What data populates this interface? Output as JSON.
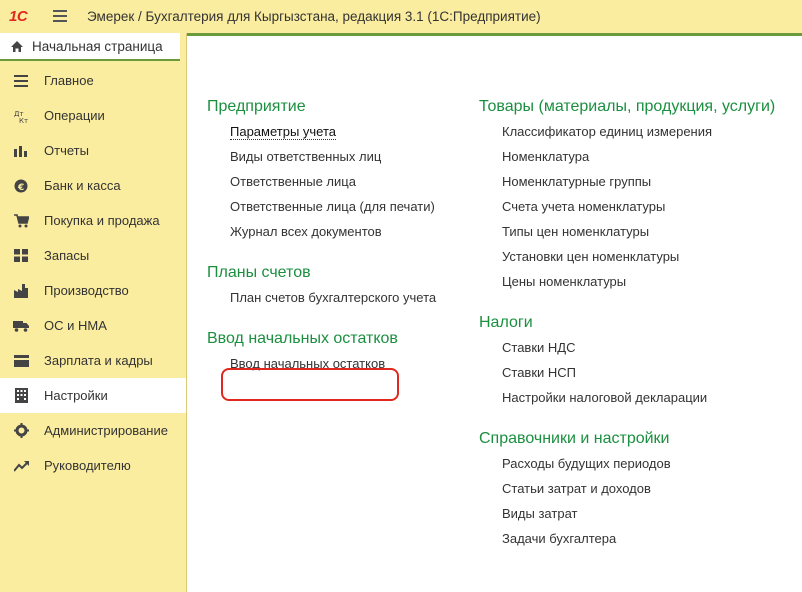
{
  "titlebar": {
    "logo": "1С",
    "title": "Эмерек / Бухгалтерия для Кыргызстана, редакция 3.1   (1С:Предприятие)"
  },
  "sidebar": {
    "home_label": "Начальная страница",
    "items": [
      {
        "label": "Главное",
        "icon": "list-icon"
      },
      {
        "label": "Операции",
        "icon": "operations-icon"
      },
      {
        "label": "Отчеты",
        "icon": "bar-chart-icon"
      },
      {
        "label": "Банк и касса",
        "icon": "coin-icon"
      },
      {
        "label": "Покупка и продажа",
        "icon": "cart-icon"
      },
      {
        "label": "Запасы",
        "icon": "grid-icon"
      },
      {
        "label": "Производство",
        "icon": "factory-icon"
      },
      {
        "label": "ОС и НМА",
        "icon": "truck-icon"
      },
      {
        "label": "Зарплата и кадры",
        "icon": "wallet-icon"
      },
      {
        "label": "Настройки",
        "icon": "building-icon",
        "active": true
      },
      {
        "label": "Администрирование",
        "icon": "gear-icon"
      },
      {
        "label": "Руководителю",
        "icon": "trend-icon"
      }
    ]
  },
  "main": {
    "left_groups": [
      {
        "title": "Предприятие",
        "links": [
          "Параметры учета",
          "Виды ответственных лиц",
          "Ответственные лица",
          "Ответственные лица (для печати)",
          "Журнал всех документов"
        ]
      },
      {
        "title": "Планы счетов",
        "links": [
          "План счетов бухгалтерского учета"
        ]
      },
      {
        "title": "Ввод начальных остатков",
        "links": [
          "Ввод начальных остатков"
        ]
      }
    ],
    "right_groups": [
      {
        "title": "Товары (материалы, продукция, услуги)",
        "links": [
          "Классификатор единиц измерения",
          "Номенклатура",
          "Номенклатурные группы",
          "Счета учета номенклатуры",
          "Типы цен номенклатуры",
          "Установки цен номенклатуры",
          "Цены номенклатуры"
        ]
      },
      {
        "title": "Налоги",
        "links": [
          "Ставки НДС",
          "Ставки НСП",
          "Настройки налоговой декларации"
        ]
      },
      {
        "title": "Справочники и настройки",
        "links": [
          "Расходы будущих периодов",
          "Статьи затрат и доходов",
          "Виды затрат",
          "Задачи бухгалтера"
        ]
      }
    ]
  },
  "colors": {
    "accent_green": "#1b8f3f",
    "sidebar_bg": "#fbeda0",
    "highlight_red": "#e0281f"
  }
}
